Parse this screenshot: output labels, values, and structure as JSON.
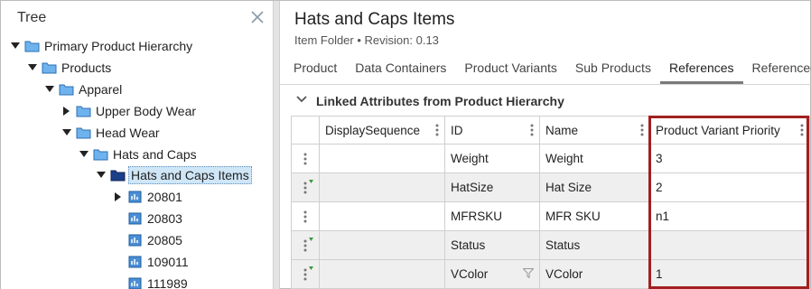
{
  "tree": {
    "title": "Tree",
    "nodes": [
      {
        "label": "Primary Product Hierarchy",
        "expanded": true,
        "icon": "folder-icon"
      },
      {
        "label": "Products",
        "expanded": true,
        "icon": "folder-icon"
      },
      {
        "label": "Apparel",
        "expanded": true,
        "icon": "folder-icon"
      },
      {
        "label": "Upper Body Wear",
        "expanded": false,
        "icon": "folder-icon"
      },
      {
        "label": "Head Wear",
        "expanded": true,
        "icon": "folder-icon"
      },
      {
        "label": "Hats and Caps",
        "expanded": true,
        "icon": "folder-icon"
      },
      {
        "label": "Hats and Caps Items",
        "expanded": true,
        "icon": "item-folder-icon",
        "selected": true
      },
      {
        "label": "20801",
        "expanded": false,
        "icon": "product-icon"
      },
      {
        "label": "20803",
        "icon": "product-icon"
      },
      {
        "label": "20805",
        "icon": "product-icon"
      },
      {
        "label": "109011",
        "icon": "product-icon"
      },
      {
        "label": "111989",
        "icon": "product-icon"
      }
    ]
  },
  "header": {
    "title": "Hats and Caps Items",
    "subtitle": "Item Folder • Revision: 0.13"
  },
  "tabs": [
    "Product",
    "Data Containers",
    "Product Variants",
    "Sub Products",
    "References",
    "Referenced"
  ],
  "active_tab": "References",
  "section": {
    "title": "Linked Attributes from Product Hierarchy"
  },
  "grid": {
    "columns": [
      "DisplaySequence",
      "ID",
      "Name",
      "Product Variant Priority"
    ],
    "rows": [
      {
        "display_sequence": "",
        "id": "Weight",
        "name": "Weight",
        "priority": "3"
      },
      {
        "display_sequence": "",
        "id": "HatSize",
        "name": "Hat Size",
        "priority": "2"
      },
      {
        "display_sequence": "",
        "id": "MFRSKU",
        "name": "MFR SKU",
        "priority": "n1"
      },
      {
        "display_sequence": "",
        "id": "Status",
        "name": "Status",
        "priority": ""
      },
      {
        "display_sequence": "",
        "id": "VColor",
        "name": "VColor",
        "priority": "1"
      }
    ]
  },
  "colors": {
    "highlight": "#a02020",
    "folder": "#2d86d9",
    "selection": "#cfe6f7"
  }
}
